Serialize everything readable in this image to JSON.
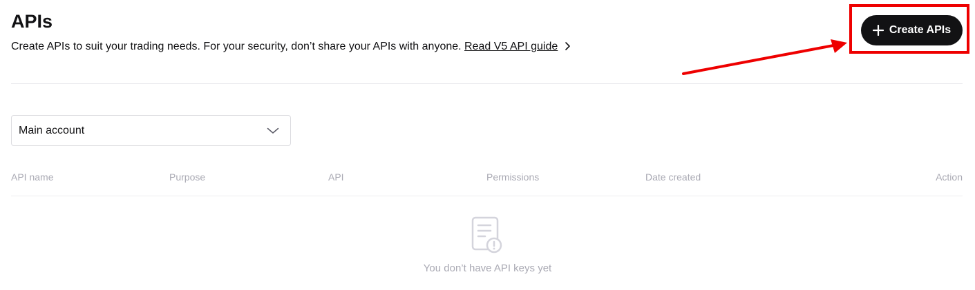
{
  "header": {
    "title": "APIs",
    "description": "Create APIs to suit your trading needs. For your security, don’t share your APIs with anyone.",
    "guide_link": "Read V5 API guide",
    "create_button": "Create APIs"
  },
  "filter": {
    "account_selected": "Main account"
  },
  "table": {
    "columns": [
      "API name",
      "Purpose",
      "API",
      "Permissions",
      "Date created",
      "Action"
    ],
    "empty_message": "You don’t have API keys yet"
  },
  "colors": {
    "primary_button": "#121214",
    "highlight": "#ee0000",
    "muted_text": "#a9a9b3"
  }
}
